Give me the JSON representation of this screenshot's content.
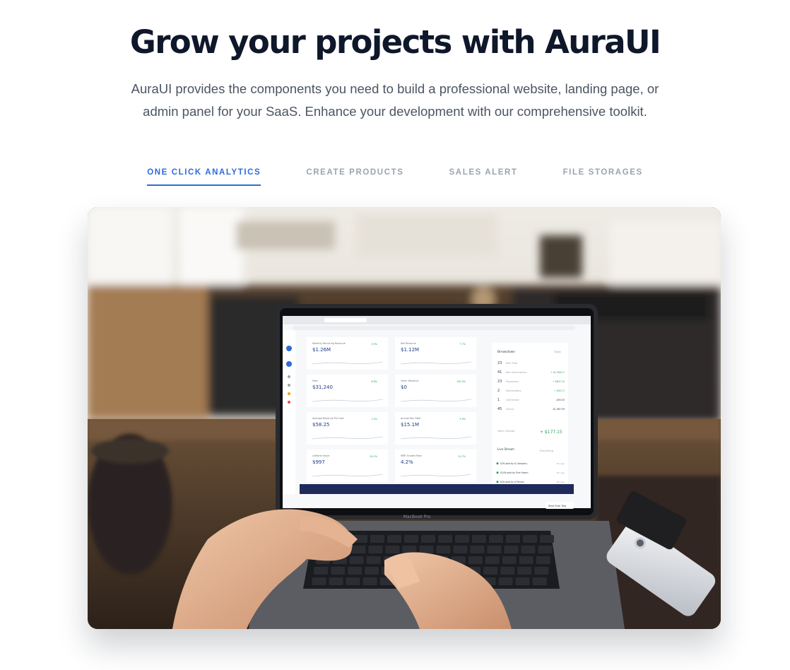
{
  "hero": {
    "title": "Grow your projects with AuraUI",
    "description": "AuraUI provides the components you need to build a professional website, landing page, or admin panel for your SaaS. Enhance your development with our comprehensive toolkit."
  },
  "tabs": [
    {
      "label": "ONE CLICK ANALYTICS",
      "active": true
    },
    {
      "label": "CREATE PRODUCTS",
      "active": false
    },
    {
      "label": "SALES ALERT",
      "active": false
    },
    {
      "label": "FILE STORAGES",
      "active": false
    }
  ],
  "photo": {
    "laptop_brand": "MacBook Pro",
    "dashboard": {
      "cards": [
        {
          "label": "Monthly Recurring Revenue",
          "value": "$1.26M",
          "change": "3.9%"
        },
        {
          "label": "Net Revenue",
          "value": "$1.12M",
          "change": "7.7%"
        },
        {
          "label": "Fees",
          "value": "$31,240",
          "change": "8.6%"
        },
        {
          "label": "Other Revenue",
          "value": "$0",
          "change": "100.0%"
        },
        {
          "label": "Average Revenue Per User",
          "value": "$58.25",
          "change": "1.5%"
        },
        {
          "label": "Annual Run Rate",
          "value": "$15.1M",
          "change": "3.9%"
        },
        {
          "label": "Lifetime Value",
          "value": "$997",
          "change": "16.2%"
        },
        {
          "label": "MRR Growth Rate",
          "value": "4.2%",
          "change": "10.7%"
        }
      ],
      "breakdown": {
        "title": "Breakdown",
        "period": "Today",
        "rows": [
          {
            "count": "23",
            "label": "New Trials",
            "amount": ""
          },
          {
            "count": "41",
            "label": "New Subscriptions",
            "amount": "+ $1,558.17"
          },
          {
            "count": "23",
            "label": "Expansions",
            "amount": "+ $837.10"
          },
          {
            "count": "2",
            "label": "Reactivations",
            "amount": "+ $92.17"
          },
          {
            "count": "1",
            "label": "Contraction",
            "amount": "-$90.00"
          },
          {
            "count": "45",
            "label": "Churns",
            "amount": "-$1,987.09"
          }
        ],
        "total_label": "Total Change",
        "total_value": "+ $177.15"
      },
      "live_stream": {
        "title": "Live Stream",
        "filter": "Everything",
        "items": [
          {
            "text": "$29 paid by A Company",
            "time": "4m ago",
            "color": "#22a35a"
          },
          {
            "text": "$149 paid by Five Haven",
            "time": "6m ago",
            "color": "#22a35a"
          },
          {
            "text": "$29 paid by A Person",
            "time": "8m ago",
            "color": "#22a35a"
          },
          {
            "text": "$59 payment failed by Company",
            "time": "10m ago",
            "color": "#e53935"
          }
        ],
        "cta": "Start Free Trial"
      }
    }
  },
  "colors": {
    "accent": "#2e6bdb",
    "heading": "#0f172a",
    "muted": "#9ca3af"
  }
}
